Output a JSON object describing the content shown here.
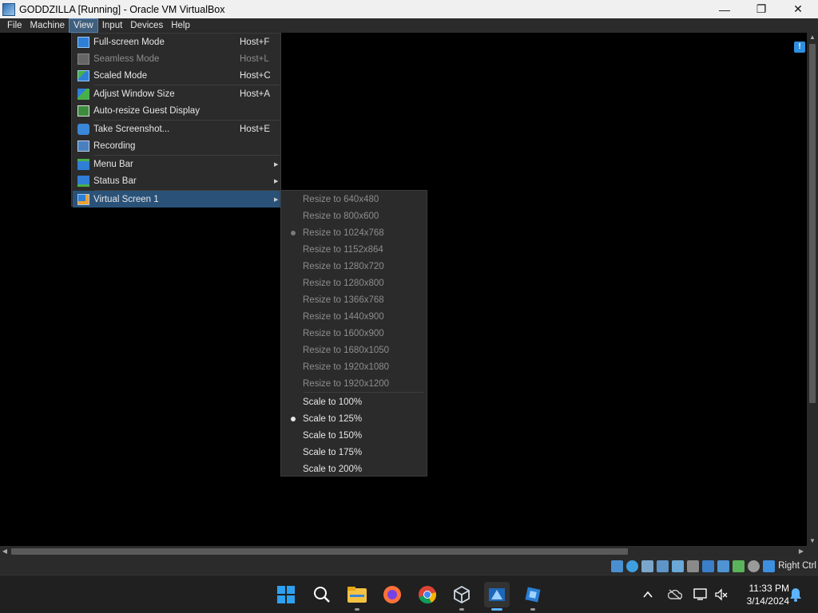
{
  "window": {
    "title": "GODDZILLA [Running] - Oracle VM VirtualBox",
    "controls": [
      "—",
      "❐",
      "✕"
    ]
  },
  "menubar": {
    "items": [
      "File",
      "Machine",
      "View",
      "Input",
      "Devices",
      "Help"
    ],
    "active": "View"
  },
  "view_menu": {
    "items": [
      {
        "label": "Full-screen Mode",
        "shortcut": "Host+F",
        "icon": "fullscreen-icon",
        "enabled": true
      },
      {
        "label": "Seamless Mode",
        "shortcut": "Host+L",
        "icon": "seamless-icon",
        "enabled": false
      },
      {
        "label": "Scaled Mode",
        "shortcut": "Host+C",
        "icon": "scaled-mode-icon",
        "enabled": true
      },
      {
        "label": "Adjust Window Size",
        "shortcut": "Host+A",
        "icon": "adjust-window-icon",
        "enabled": true
      },
      {
        "label": "Auto-resize Guest Display",
        "shortcut": "",
        "icon": "auto-resize-icon",
        "enabled": true
      },
      {
        "label": "Take Screenshot...",
        "shortcut": "Host+E",
        "icon": "screenshot-icon",
        "enabled": true
      },
      {
        "label": "Recording",
        "shortcut": "",
        "icon": "recording-icon",
        "enabled": true
      },
      {
        "label": "Menu Bar",
        "shortcut": "",
        "icon": "menu-bar-icon",
        "enabled": true,
        "submenu": true
      },
      {
        "label": "Status Bar",
        "shortcut": "",
        "icon": "status-bar-icon",
        "enabled": true,
        "submenu": true
      },
      {
        "label": "Virtual Screen 1",
        "shortcut": "",
        "icon": "virtual-screen-icon",
        "enabled": true,
        "submenu": true,
        "selected": true
      }
    ]
  },
  "virtual_screen_submenu": {
    "resize_items": [
      {
        "label": "Resize to 640x480",
        "checked": false
      },
      {
        "label": "Resize to 800x600",
        "checked": false
      },
      {
        "label": "Resize to 1024x768",
        "checked": true
      },
      {
        "label": "Resize to 1152x864",
        "checked": false
      },
      {
        "label": "Resize to 1280x720",
        "checked": false
      },
      {
        "label": "Resize to 1280x800",
        "checked": false
      },
      {
        "label": "Resize to 1366x768",
        "checked": false
      },
      {
        "label": "Resize to 1440x900",
        "checked": false
      },
      {
        "label": "Resize to 1600x900",
        "checked": false
      },
      {
        "label": "Resize to 1680x1050",
        "checked": false
      },
      {
        "label": "Resize to 1920x1080",
        "checked": false
      },
      {
        "label": "Resize to 1920x1200",
        "checked": false
      }
    ],
    "scale_items": [
      {
        "label": "Scale to 100%",
        "checked": false
      },
      {
        "label": "Scale to 125%",
        "checked": true
      },
      {
        "label": "Scale to 150%",
        "checked": false
      },
      {
        "label": "Scale to 175%",
        "checked": false
      },
      {
        "label": "Scale to 200%",
        "checked": false
      }
    ]
  },
  "statusbar": {
    "icons": [
      "hard-disk-icon",
      "optical-drive-icon",
      "audio-icon",
      "network-icon",
      "usb-icon",
      "shared-folders-icon",
      "display-icon",
      "recording-status-icon",
      "guest-additions-icon",
      "cpu-icon",
      "mouse-integration-icon",
      "keyboard-capture-icon"
    ],
    "host_key": "Right Ctrl"
  },
  "taskbar": {
    "apps": [
      "start-icon",
      "search-icon",
      "file-explorer-icon",
      "firefox-icon",
      "chrome-icon",
      "virtualbox-icon",
      "virtualbox-vm-icon",
      "vm-app-icon"
    ],
    "tray_icons": [
      "chevron-up-icon",
      "onedrive-icon",
      "network-tray-icon",
      "volume-muted-icon"
    ],
    "time": "11:33 PM",
    "date": "3/14/2024"
  },
  "colors": {
    "menu_bg": "#2b2b2b",
    "menu_selected": "#2a5278",
    "taskbar_bg": "#202020"
  }
}
